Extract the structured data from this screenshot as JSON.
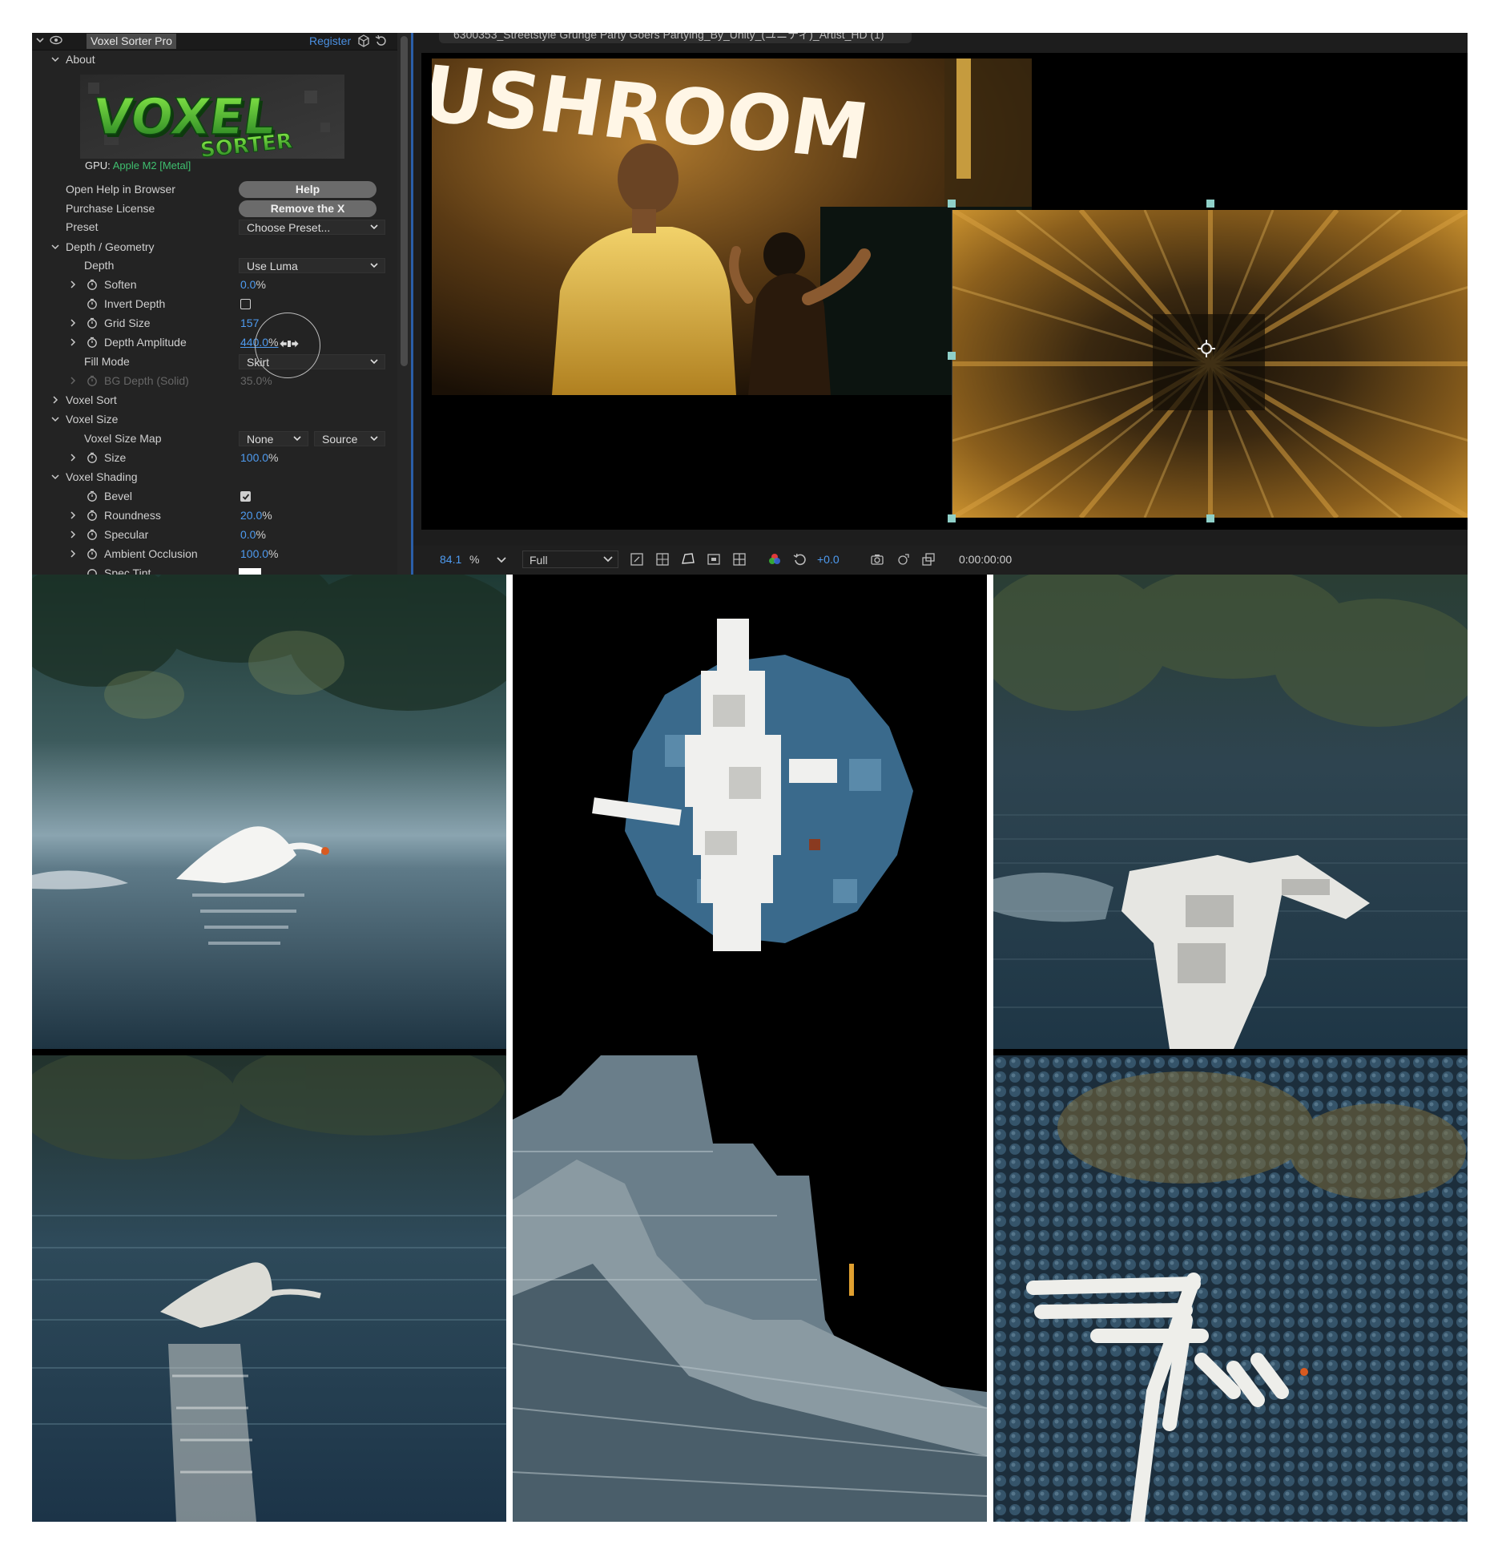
{
  "panel": {
    "effect_name": "Voxel Sorter Pro",
    "register": "Register",
    "about_label": "About",
    "logo_text_1": "VOXEL",
    "logo_text_2": "SORTER",
    "gpu_label": "GPU:",
    "gpu_value": "Apple M2 [Metal]",
    "open_help_label": "Open Help in Browser",
    "help_button": "Help",
    "purchase_label": "Purchase License",
    "remove_x_button": "Remove the X",
    "preset_label": "Preset",
    "preset_value": "Choose Preset...",
    "depth_geometry_label": "Depth / Geometry",
    "depth_label": "Depth",
    "depth_value": "Use Luma",
    "soften_label": "Soften",
    "soften_value": "0.0",
    "invert_depth_label": "Invert Depth",
    "invert_depth_checked": false,
    "grid_size_label": "Grid Size",
    "grid_size_value": "157",
    "depth_amplitude_label": "Depth Amplitude",
    "depth_amplitude_value": "440.0",
    "fill_mode_label": "Fill Mode",
    "fill_mode_value": "Skirt",
    "bg_depth_label": "BG Depth (Solid)",
    "bg_depth_value": "35.0",
    "voxel_sort_label": "Voxel Sort",
    "voxel_size_label": "Voxel Size",
    "voxel_size_map_label": "Voxel Size Map",
    "voxel_size_map_value": "None",
    "voxel_size_map_source": "Source",
    "size_label": "Size",
    "size_value": "100.0",
    "voxel_shading_label": "Voxel Shading",
    "bevel_label": "Bevel",
    "bevel_checked": true,
    "roundness_label": "Roundness",
    "roundness_value": "20.0",
    "specular_label": "Specular",
    "specular_value": "0.0",
    "ambient_occlusion_label": "Ambient Occlusion",
    "ambient_occlusion_value": "100.0",
    "spec_tint_label": "Spec Tint",
    "percent": "%"
  },
  "viewer": {
    "comp_tab": "6300353_Streetstyle Grunge Party Goers Partying_By_Unity_(ユニティ)_Artist_HD (1)",
    "sign_text": "USHROOM",
    "zoom_value": "84.1",
    "zoom_unit": "%",
    "resolution": "Full",
    "exposure": "+0.0",
    "timecode": "0:00:00:00"
  },
  "colors": {
    "accent_blue": "#4e9bf0",
    "gpu_green": "#3fbf6f",
    "handle_teal": "#8fd0c8"
  }
}
